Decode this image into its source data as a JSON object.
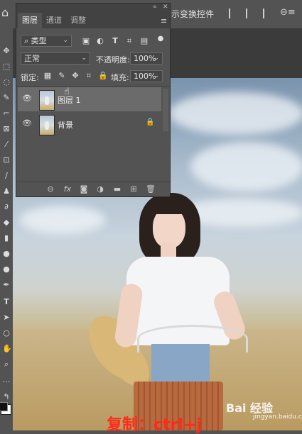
{
  "options_bar": {
    "transform_controls_label": "示变换控件"
  },
  "layers_panel": {
    "tabs": [
      {
        "label": "图层"
      },
      {
        "label": "通道"
      },
      {
        "label": "调整"
      }
    ],
    "filter_kind": "类型",
    "blend_mode": "正常",
    "opacity_label": "不透明度:",
    "opacity_value": "100%",
    "lock_label": "锁定:",
    "fill_label": "填充:",
    "fill_value": "100%",
    "layers": [
      {
        "name": "图层 1",
        "visible": true,
        "selected": true,
        "locked": false
      },
      {
        "name": "背景",
        "visible": true,
        "selected": false,
        "locked": true
      }
    ]
  },
  "overlay": {
    "caption": "复制：ctrl+j",
    "watermark": "Bai 经验",
    "watermark_url": "jingyan.baidu.com"
  },
  "colors": {
    "panel_bg": "#535353",
    "selected_layer": "#6b6b6b",
    "caption_red": "#ff2a1a"
  }
}
